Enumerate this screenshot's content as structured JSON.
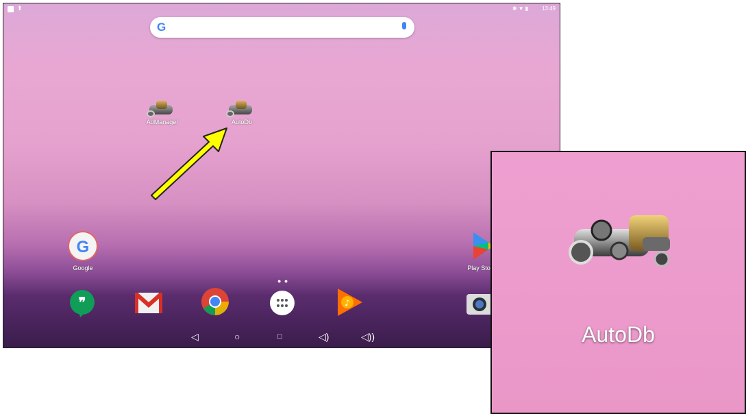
{
  "status_bar": {
    "time": "13:49",
    "icons": [
      "notification-icon",
      "upload-icon",
      "bluetooth-icon",
      "wifi-icon",
      "battery-icon"
    ]
  },
  "search": {
    "logo": "G",
    "icon": "mic-icon"
  },
  "home_apps": [
    {
      "label": "AdManager",
      "icon": "engine-icon"
    },
    {
      "label": "AutoDb",
      "icon": "engine-icon"
    }
  ],
  "favorites": [
    {
      "label": "Google",
      "icon": "google-icon"
    },
    {
      "label": "Play Store",
      "icon": "play-store-icon"
    }
  ],
  "dock": [
    "hangouts-icon",
    "gmail-icon",
    "chrome-icon",
    "app-drawer-icon",
    "play-music-icon",
    "camera-icon"
  ],
  "nav_buttons": [
    "back-icon",
    "home-icon",
    "recents-icon",
    "volume-down-icon",
    "volume-up-icon"
  ],
  "zoom_inset": {
    "label": "AutoDb"
  },
  "annotation": {
    "arrow_color": "#ffff00",
    "points_to": "AutoDb"
  }
}
